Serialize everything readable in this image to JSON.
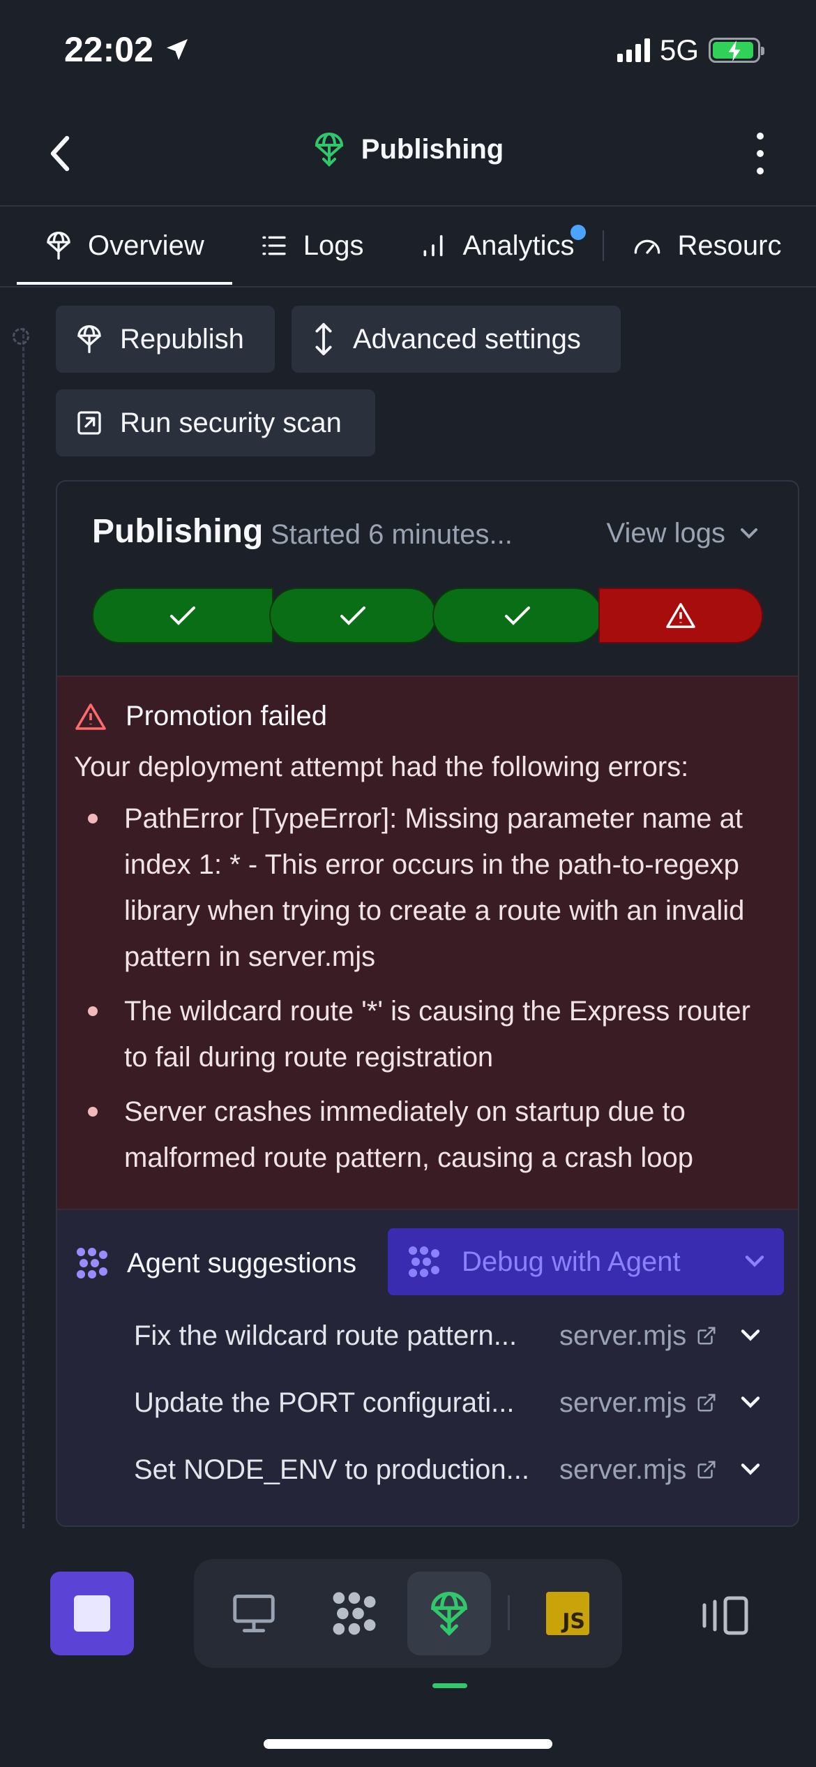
{
  "status": {
    "time": "22:02",
    "network": "5G"
  },
  "header": {
    "title": "Publishing"
  },
  "tabs": [
    {
      "label": "Overview",
      "icon": "deploy-icon",
      "active": true
    },
    {
      "label": "Logs",
      "icon": "list-icon"
    },
    {
      "label": "Analytics",
      "icon": "bar-chart-icon",
      "has_notification": true
    },
    {
      "label": "Resourc",
      "icon": "gauge-icon"
    }
  ],
  "actions": {
    "republish": "Republish",
    "advanced": "Advanced settings",
    "security_scan": "Run security scan"
  },
  "publishing": {
    "title": "Publishing",
    "started": "Started 6 minutes...",
    "view_logs": "View logs",
    "steps": [
      "success",
      "success",
      "success",
      "error"
    ]
  },
  "error": {
    "title": "Promotion failed",
    "intro": "Your deployment attempt had the following errors:",
    "items": [
      "PathError [TypeError]: Missing parameter name at index 1: * - This error occurs in the path-to-regexp library when trying to create a route with an invalid pattern in server.mjs",
      "The wildcard route '*' is causing the Express router to fail during route registration",
      "Server crashes immediately on startup due to malformed route pattern, causing a crash loop"
    ]
  },
  "agent": {
    "label": "Agent suggestions",
    "debug_button": "Debug with Agent",
    "suggestions": [
      {
        "text": "Fix the wildcard route pattern...",
        "file": "server.mjs"
      },
      {
        "text": "Update the PORT configurati...",
        "file": "server.mjs"
      },
      {
        "text": "Set NODE_ENV to production...",
        "file": "server.mjs"
      }
    ]
  },
  "colors": {
    "accent": "#5b43d6",
    "success": "#0a6e16",
    "error": "#a80d0d",
    "publish_green": "#30c86a"
  }
}
